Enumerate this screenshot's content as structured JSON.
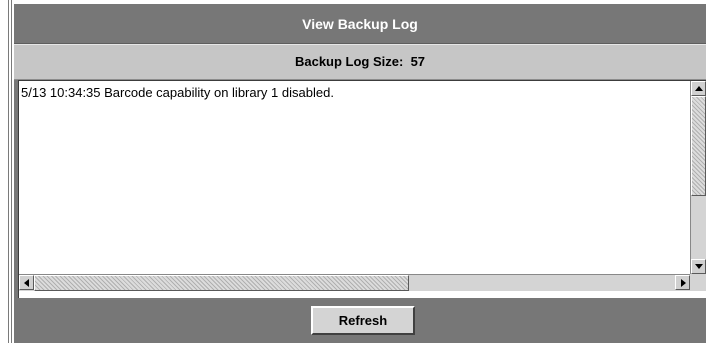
{
  "window": {
    "title": "View Backup Log"
  },
  "log_size": {
    "label": "Backup Log Size:",
    "value": "57"
  },
  "log": {
    "lines": [
      "5/13 10:34:35 Barcode capability on library 1 disabled."
    ]
  },
  "scrollbar_icons": {
    "up": "scroll-up-arrow-icon",
    "down": "scroll-down-arrow-icon",
    "left": "scroll-left-arrow-icon",
    "right": "scroll-right-arrow-icon"
  },
  "actions": {
    "refresh_label": "Refresh"
  },
  "colors": {
    "panel": "#777777",
    "header_band": "#c6c6c6",
    "button_face": "#d4d4d4"
  }
}
